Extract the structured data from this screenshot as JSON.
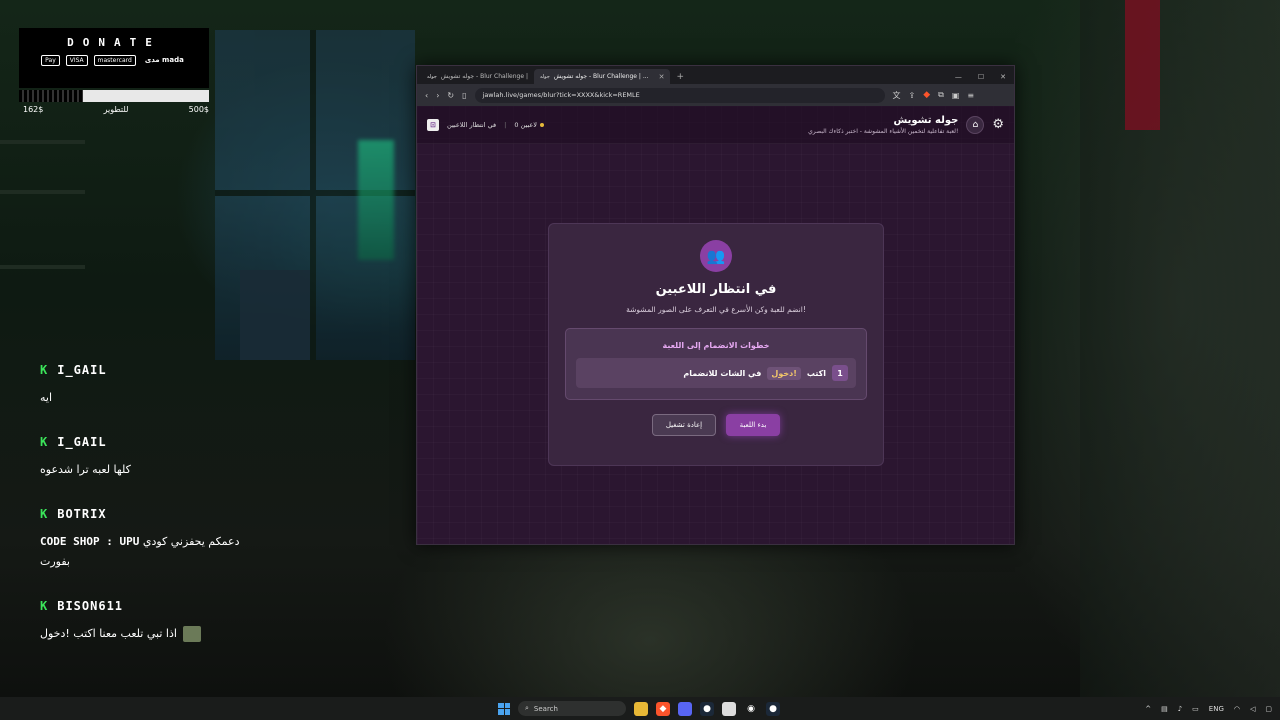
{
  "donate": {
    "title": "DONATE",
    "methods": [
      "Pay",
      "VISA",
      "mastercard",
      "مدى mada"
    ],
    "current": "162$",
    "goal_label": "للتطوير",
    "goal": "500$"
  },
  "chat": [
    {
      "badge": "K",
      "user": "I_GAIL",
      "message": "ايه"
    },
    {
      "badge": "K",
      "user": "I_GAIL",
      "message": "كلها لعبه ترا شدعوه"
    },
    {
      "badge": "K",
      "user": "BOTRIX",
      "message_prefix": "CODE SHOP : UPU",
      "message": "دعمكم يحفزني كودي بفورت"
    },
    {
      "badge": "K",
      "user": "BISON611",
      "message": "اذا تبي تلعب معنا اكتب !دخول"
    }
  ],
  "browser": {
    "tabs": [
      {
        "logo": "جوله",
        "title": "جوله تشويش - Blur Challenge |"
      },
      {
        "logo": "جوله",
        "title": "جوله تشويش - Blur Challenge | ..."
      }
    ],
    "new_tab": "+",
    "url": "jawlah.live/games/blur?tick=XXXX&kick=REMLE"
  },
  "site": {
    "status_waiting": "في انتظار اللاعبين",
    "players_count": "0 لاعبين",
    "title": "جوله تشويش",
    "subtitle": "لعبة تفاعلية لتخمين الأشياء المشوشة - اختبر ذكاءك البصري!"
  },
  "card": {
    "title": "في انتظار اللاعبين",
    "subtitle": "انضم للعبة وكن الأسرع في التعرف على الصور المشوشة!",
    "steps_title": "خطوات الانضمام إلى اللعبة",
    "step_number": "1",
    "step_write": "اكتب",
    "step_keyword": "!دخول",
    "step_rest": "في الشات للانضمام",
    "reset_button": "إعادة تشغيل",
    "start_button": "بدء اللعبة"
  },
  "taskbar": {
    "search_placeholder": "Search",
    "lang": "ENG"
  },
  "colors": {
    "accent": "#8a3fa3",
    "kick_green": "#3be45a",
    "page_bg": "#2b1630",
    "keyword": "#f1c66a"
  }
}
